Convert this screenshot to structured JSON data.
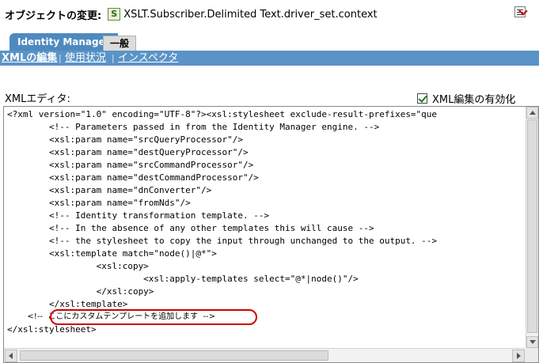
{
  "header": {
    "title": "オブジェクトの変更:",
    "object_icon_glyph": "S",
    "object_name": "XSLT.Subscriber.Delimited Text.driver_set.context"
  },
  "tabs": [
    {
      "label": "Identity Manager",
      "active": true
    },
    {
      "label": "一般",
      "active": false
    }
  ],
  "subnav": {
    "items": [
      {
        "label": "XMLの編集",
        "active": true
      },
      {
        "label": "使用状況",
        "active": false
      },
      {
        "label": "インスペクタ",
        "active": false
      }
    ],
    "separator": "|"
  },
  "editor": {
    "label": "XMLエディタ:",
    "enable_toggle_label": "XML編集の有効化",
    "enable_toggle_checked": true,
    "lines": [
      "<?xml version=\"1.0\" encoding=\"UTF-8\"?><xsl:stylesheet exclude-result-prefixes=\"que",
      "        <!-- Parameters passed in from the Identity Manager engine. -->",
      "        <xsl:param name=\"srcQueryProcessor\"/>",
      "        <xsl:param name=\"destQueryProcessor\"/>",
      "        <xsl:param name=\"srcCommandProcessor\"/>",
      "        <xsl:param name=\"destCommandProcessor\"/>",
      "        <xsl:param name=\"dnConverter\"/>",
      "        <xsl:param name=\"fromNds\"/>",
      "        <!-- Identity transformation template. -->",
      "        <!-- In the absence of any other templates this will cause -->",
      "        <!-- the stylesheet to copy the input through unchanged to the output. -->",
      "        <xsl:template match=\"node()|@*\">",
      "                 <xsl:copy>",
      "                          <xsl:apply-templates select=\"@*|node()\"/>",
      "                 </xsl:copy>",
      "        </xsl:template>",
      "        <!--  ここにカスタムテンプレートを追加します  -->",
      "</xsl:stylesheet>"
    ]
  },
  "colors": {
    "tab_active": "#4e8abf",
    "subnav_bar": "#5a93c7",
    "highlight_ring": "#d00000"
  }
}
